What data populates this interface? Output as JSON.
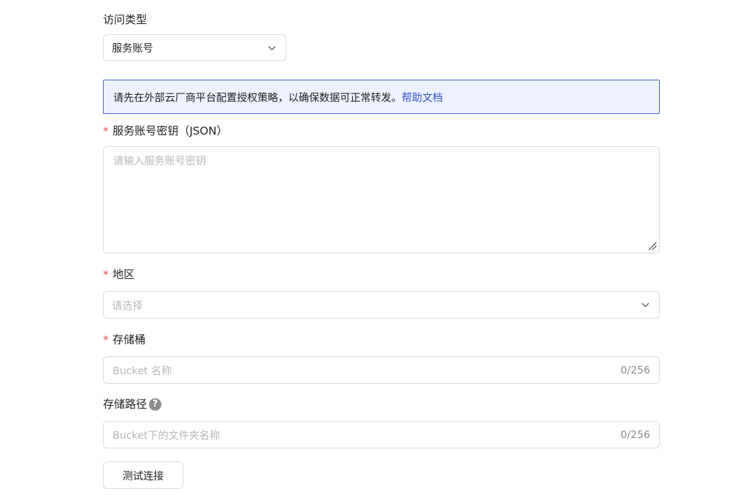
{
  "access_type": {
    "label": "访问类型",
    "selected": "服务账号"
  },
  "notice": {
    "text": "请先在外部云厂商平台配置授权策略，以确保数据可正常转发。",
    "link": "帮助文档"
  },
  "service_key": {
    "required_mark": "*",
    "label": "服务账号密钥（JSON）",
    "placeholder": "请输入服务账号密钥"
  },
  "region": {
    "required_mark": "*",
    "label": "地区",
    "placeholder": "请选择"
  },
  "bucket": {
    "required_mark": "*",
    "label": "存储桶",
    "placeholder": "Bucket 名称",
    "counter": "0/256"
  },
  "path": {
    "label": "存储路径",
    "help_icon": "question-circle-icon",
    "placeholder": "Bucket下的文件夹名称",
    "counter": "0/256"
  },
  "test_button": {
    "label": "测试连接"
  }
}
